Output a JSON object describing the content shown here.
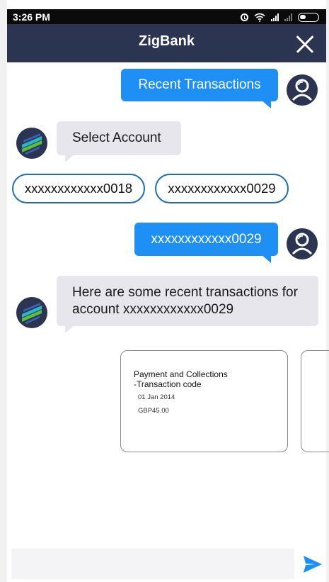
{
  "status_bar": {
    "time": "3:26 PM",
    "icons": [
      "alarm-icon",
      "wifi-icon",
      "signal-icon",
      "signal-icon",
      "battery-icon"
    ]
  },
  "header": {
    "title": "ZigBank",
    "close_icon": "close-icon",
    "background": "#2b3450"
  },
  "chat": {
    "messages": [
      {
        "sender": "user",
        "text": "Recent Transactions"
      },
      {
        "sender": "bot",
        "text": "Select Account"
      },
      {
        "sender": "user",
        "text": "xxxxxxxxxxxx0029"
      },
      {
        "sender": "bot",
        "text": "Here are some recent transactions for account xxxxxxxxxxxx0029"
      }
    ],
    "account_options": [
      "xxxxxxxxxxxx0018",
      "xxxxxxxxxxxx0029"
    ],
    "transaction_cards": [
      {
        "title_line1": "Payment and Collections",
        "title_line2": "-Transaction code",
        "date": "01 Jan 2014",
        "amount": "GBP45.00"
      }
    ]
  },
  "composer": {
    "value": "",
    "placeholder": "",
    "send_icon": "send-icon"
  },
  "colors": {
    "accent": "#1e90f5",
    "navy": "#2b3450",
    "chip_border": "#1f6fb2",
    "bot_bubble": "#e6e6ec"
  }
}
